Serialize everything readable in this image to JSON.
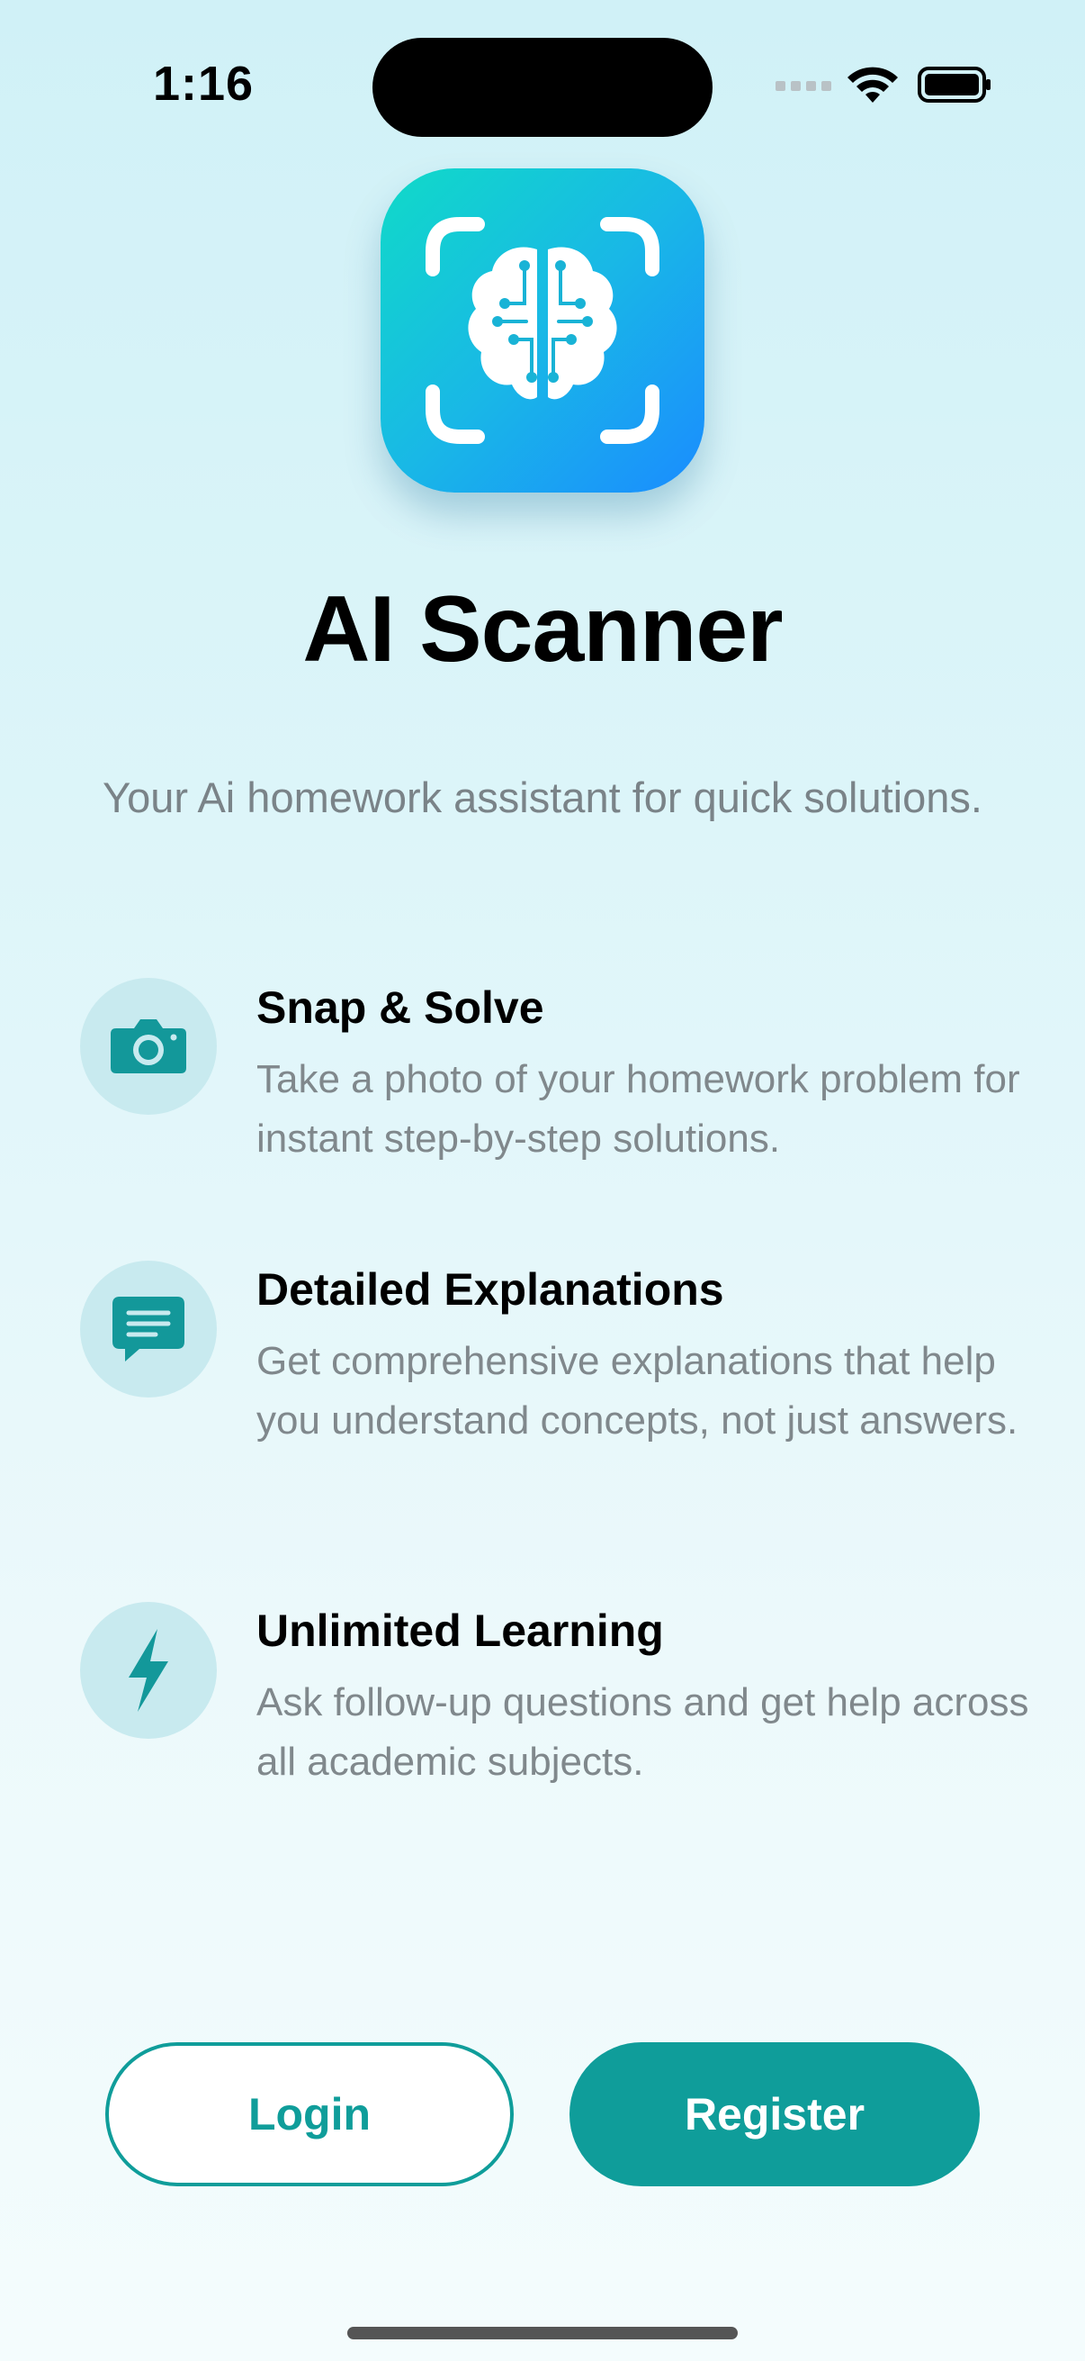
{
  "status_bar": {
    "time": "1:16"
  },
  "app": {
    "icon": "brain-scanner-icon",
    "title": "AI Scanner",
    "subtitle": "Your Ai homework assistant for quick solutions."
  },
  "features": [
    {
      "icon": "camera-icon",
      "title": "Snap & Solve",
      "description": "Take a photo of your homework problem for instant step-by-step solutions."
    },
    {
      "icon": "chat-bubble-icon",
      "title": "Detailed Explanations",
      "description": "Get comprehensive explanations that help you understand concepts, not just answers."
    },
    {
      "icon": "lightning-icon",
      "title": "Unlimited Learning",
      "description": "Ask follow-up questions and get help across all academic subjects."
    }
  ],
  "actions": {
    "login_label": "Login",
    "register_label": "Register"
  },
  "colors": {
    "accent": "#0f9d9a",
    "icon_gradient_start": "#10dac8",
    "icon_gradient_end": "#1a8cff",
    "feature_icon_bg": "#c8eaef"
  }
}
